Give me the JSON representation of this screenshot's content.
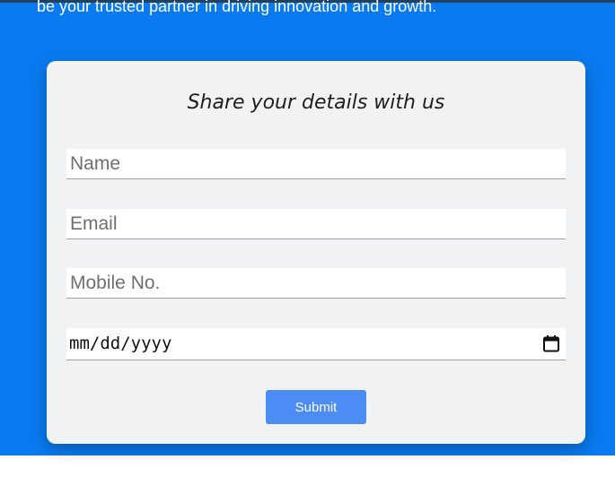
{
  "hero": {
    "text": "be your trusted partner in driving innovation and growth."
  },
  "form": {
    "title": "Share your details with us",
    "name_placeholder": "Name",
    "email_placeholder": "Email",
    "mobile_placeholder": "Mobile No.",
    "date_placeholder": "mm/dd/yyyy",
    "date_icon": "calendar-icon",
    "submit_label": "Submit"
  },
  "colors": {
    "hero_background": "#0a7af0",
    "card_background": "#f1f2f4",
    "submit_button": "#4b8cf5"
  }
}
